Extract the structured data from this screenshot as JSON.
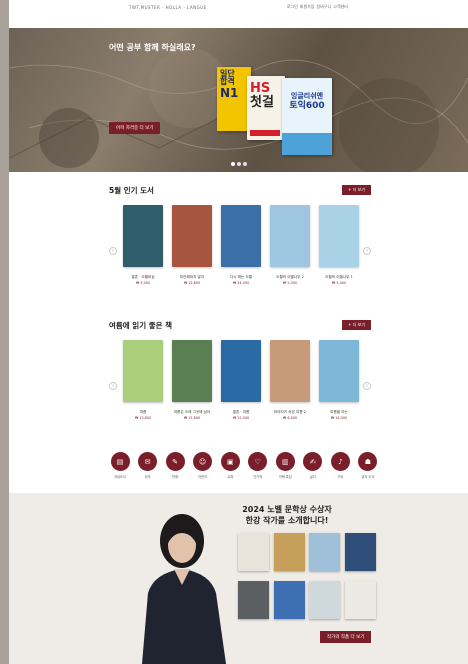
{
  "topbar": {
    "brand": "TWT.MUSTER · HOLLA - LANGUE",
    "links": [
      "로그인",
      "회원가입",
      "장바구니",
      "고객센터"
    ]
  },
  "hero": {
    "title": "어떤 공부 함께 하실래요?",
    "button_label": "어학 자격증 더 보기",
    "book1_lines": [
      "일단",
      "합격",
      "N1"
    ],
    "book2_lines": [
      "HS",
      "첫걸"
    ],
    "book3_lines": [
      "잉글리쉬앤",
      "토익600"
    ]
  },
  "section1": {
    "title": "5월 인기 도서",
    "more_label": "+ 더 보기",
    "books": [
      {
        "title": "결혼 · 오월비상",
        "meta": "",
        "price": "₩ 5,000",
        "color": "#2f5d6b"
      },
      {
        "title": "미안해하지 말자",
        "meta": "",
        "price": "₩ 15,800",
        "color": "#a7553f"
      },
      {
        "title": "다시 떠는 오월",
        "meta": "",
        "price": "₩ 14,000",
        "color": "#3a6fa8"
      },
      {
        "title": "오월의 이별나무 2",
        "meta": "",
        "price": "₩ 5,000",
        "color": "#9fc6e0"
      },
      {
        "title": "오월의 이별나무 1",
        "meta": "",
        "price": "₩ 5,000",
        "color": "#a9d2e6"
      }
    ]
  },
  "section2": {
    "title": "여름에 읽기 좋은 책",
    "more_label": "+ 더 보기",
    "books": [
      {
        "title": "여름",
        "meta": "",
        "price": "₩ 13,800",
        "color": "#a9cf7d"
      },
      {
        "title": "여름은 오래 그곳에 남아",
        "meta": "",
        "price": "₩ 15,800",
        "color": "#5b7f52"
      },
      {
        "title": "결혼 · 여름",
        "meta": "",
        "price": "₩ 12,000",
        "color": "#2a6aa5"
      },
      {
        "title": "미야자키 속은 여름 2",
        "meta": "",
        "price": "₩ 6,000",
        "color": "#c79b7a"
      },
      {
        "title": "여름을 여는",
        "meta": "",
        "price": "₩ 14,000",
        "color": "#7fb7d8"
      }
    ]
  },
  "icons": [
    {
      "label": "국내도서",
      "glyph": "▤"
    },
    {
      "label": "외국",
      "glyph": "✉"
    },
    {
      "label": "만화",
      "glyph": "✎"
    },
    {
      "label": "어린이",
      "glyph": "☺"
    },
    {
      "label": "교재",
      "glyph": "▣"
    },
    {
      "label": "인기작",
      "glyph": "♡"
    },
    {
      "label": "이북 특집",
      "glyph": "▥"
    },
    {
      "label": "글자",
      "glyph": "✍"
    },
    {
      "label": "가요",
      "glyph": "♪"
    },
    {
      "label": "공지 도서",
      "glyph": "☗"
    }
  ],
  "nobel": {
    "title_line1": "2024 노벨 문학상 수상자",
    "title_line2": "한강 작가를 소개합니다!",
    "button_label": "작가의 작품 더 보기"
  },
  "colors": {
    "accent": "#7a1f2a"
  }
}
